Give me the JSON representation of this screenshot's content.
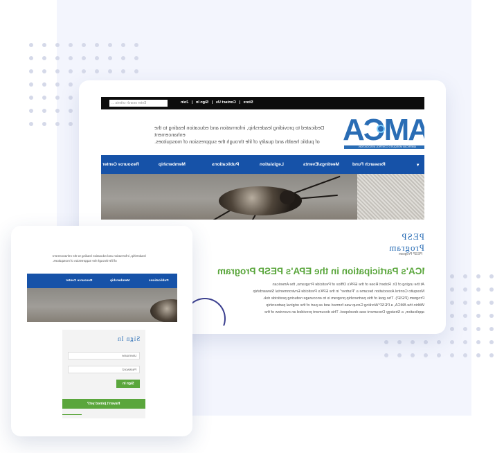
{
  "topbar": {
    "search_placeholder": "Enter search criteria ...",
    "links": [
      "Store",
      "|",
      "Contact Us",
      "|",
      "Sign In",
      "|",
      "Join"
    ]
  },
  "header": {
    "tagline_lines": [
      "Dedicated to providing leadership, information and education leading to the enhancement",
      "of public health and quality of life through the suppression of mosquitoes."
    ],
    "logo_text": "AMCA",
    "logo_subtext": "AMERICAN MOSQUITO CONTROL ASSOCIATION"
  },
  "nav": {
    "items": [
      "Resource Center",
      "Membership",
      "Publications",
      "Legislation",
      "Meetings/Events",
      "Research Fund",
      "▾"
    ]
  },
  "content": {
    "section_title": "PESP Program",
    "breadcrumb": "PESP Program",
    "headline": "AMCA's Participation in the EPA's PESP Program",
    "body_lines": [
      "At the urging of Dr. Robert Rose of the EPA's Office of Pesticide Programs, the American",
      "Mosquito Control Association became a \"Partner\" in the EPA's Pesticide Environmental Stewardship",
      "Program (PESP). The goal of this partnership program is to encourage reducing pesticide risk.",
      "Within the AMCA, a PESP Working Group was formed and as part of the original partnership",
      "application, a Strategy Document was developed. This document provided an overview of the"
    ]
  },
  "small_card": {
    "tagline_lines": [
      "leadership, information and education leading to the enhancement",
      "of life through the suppression of mosquitoes."
    ],
    "nav_items": [
      "Resource Center",
      "Membership",
      "Publications"
    ],
    "signin": {
      "title": "Sign In",
      "username_placeholder": "Username",
      "password_placeholder": "Password",
      "signin_label": "Sign In",
      "join_label": "Haven't joined yet?"
    }
  },
  "colors": {
    "accent_blue": "#1652a8",
    "accent_green": "#5aa63c",
    "background_panel": "#f3f5fd"
  }
}
